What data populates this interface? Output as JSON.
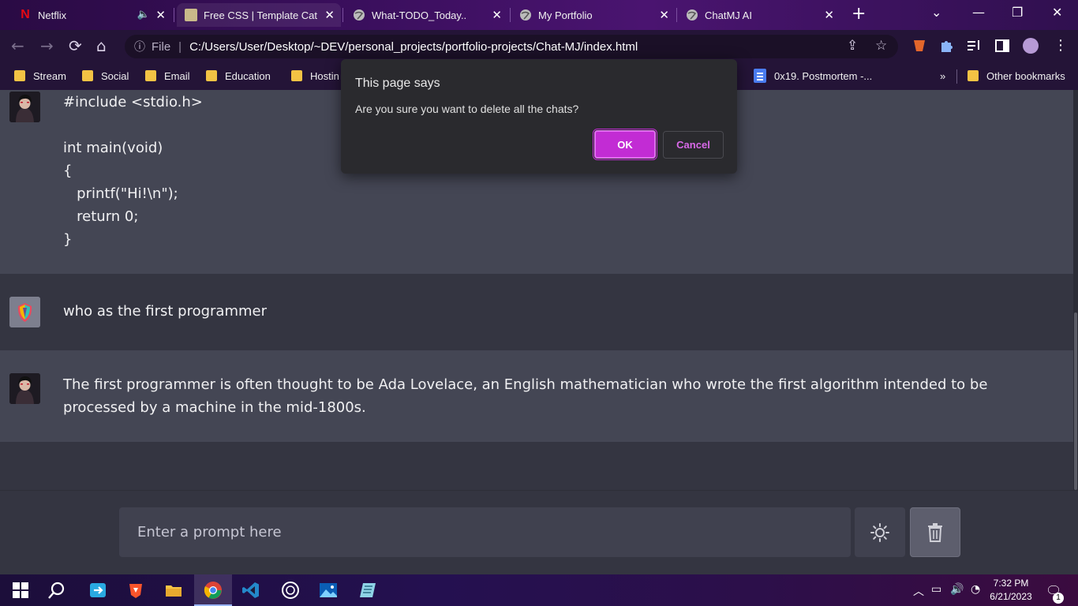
{
  "browser": {
    "tabs": [
      {
        "label": "Netflix"
      },
      {
        "label": "Free CSS | Template Cat"
      },
      {
        "label": "What-TODO_Today.."
      },
      {
        "label": "My Portfolio"
      },
      {
        "label": "ChatMJ AI"
      }
    ],
    "omnibox": {
      "scheme": "File",
      "url": "C:/Users/User/Desktop/~DEV/personal_projects/portfolio-projects/Chat-MJ/index.html"
    },
    "bookmarks": [
      {
        "label": "Stream"
      },
      {
        "label": "Social"
      },
      {
        "label": "Email"
      },
      {
        "label": "Education"
      },
      {
        "label": "Hostin"
      },
      {
        "label": "0x19. Postmortem -..."
      },
      {
        "label": "Other bookmarks"
      }
    ],
    "overflow_label": "»"
  },
  "dialog": {
    "title": "This page says",
    "message": "Are you sure you want to delete all the chats?",
    "ok_label": "OK",
    "cancel_label": "Cancel"
  },
  "chat": {
    "messages": [
      {
        "role": "bot",
        "text": "#include <stdio.h>\n\nint main(void)\n{\n   printf(\"Hi!\\n\");\n   return 0;\n}"
      },
      {
        "role": "user",
        "text": "who as the first programmer"
      },
      {
        "role": "bot",
        "text": "The first programmer is often thought to be Ada Lovelace, an English mathematician who wrote the first algorithm intended to be processed by a machine in the mid-1800s."
      }
    ]
  },
  "prompt": {
    "placeholder": "Enter a prompt here",
    "value": ""
  },
  "colors": {
    "accent": "#c22cd4",
    "background": "#343541",
    "bot_row": "#444654",
    "input": "#40414f"
  },
  "taskbar": {
    "icons": [
      "windows-start-icon",
      "search-icon",
      "app-icon",
      "brave-browser-icon",
      "file-explorer-icon",
      "chrome-icon",
      "vscode-icon",
      "chatgpt-icon",
      "photos-icon",
      "notepad-icon"
    ],
    "time": "7:32 PM",
    "date": "6/21/2023",
    "notification_count": "1"
  }
}
